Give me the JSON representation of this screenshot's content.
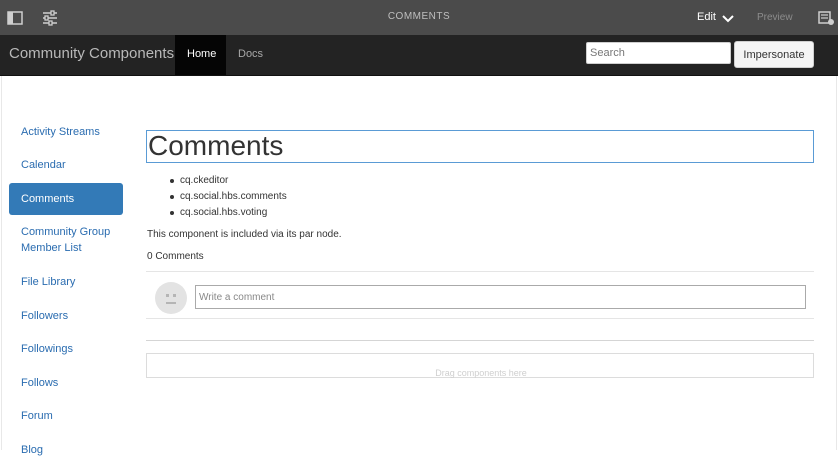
{
  "editor": {
    "title": "COMMENTS",
    "mode_label": "Edit",
    "preview_label": "Preview",
    "icons": [
      "sidebar-toggle-icon",
      "page-properties-icon",
      "chevron-down-icon",
      "annotations-icon"
    ]
  },
  "site": {
    "brand": "Community Components",
    "nav_tabs": [
      {
        "label": "Home",
        "active": true
      },
      {
        "label": "Docs",
        "active": false
      }
    ],
    "search_placeholder": "Search",
    "impersonate_label": "Impersonate"
  },
  "sidebar": {
    "items": [
      {
        "label": "Activity Streams"
      },
      {
        "label": "Calendar"
      },
      {
        "label": "Comments",
        "active": true
      },
      {
        "label": "Community Group Member List"
      },
      {
        "label": "File Library"
      },
      {
        "label": "Followers"
      },
      {
        "label": "Followings"
      },
      {
        "label": "Follows"
      },
      {
        "label": "Forum"
      },
      {
        "label": "Blog"
      }
    ]
  },
  "main": {
    "title": "Comments",
    "libraries": [
      "cq.ckeditor",
      "cq.social.hbs.comments",
      "cq.social.hbs.voting"
    ],
    "note": "This component is included via its par node.",
    "comment_count": "0 Comments",
    "comment_placeholder": "Write a comment",
    "drop_zone_label": "Drag components here"
  },
  "colors": {
    "editor_bar": "#4b4b4b",
    "nav_bar": "#232323",
    "link": "#2a6cb0",
    "active_item": "#337ab7",
    "title_border": "#5a9bd5"
  }
}
